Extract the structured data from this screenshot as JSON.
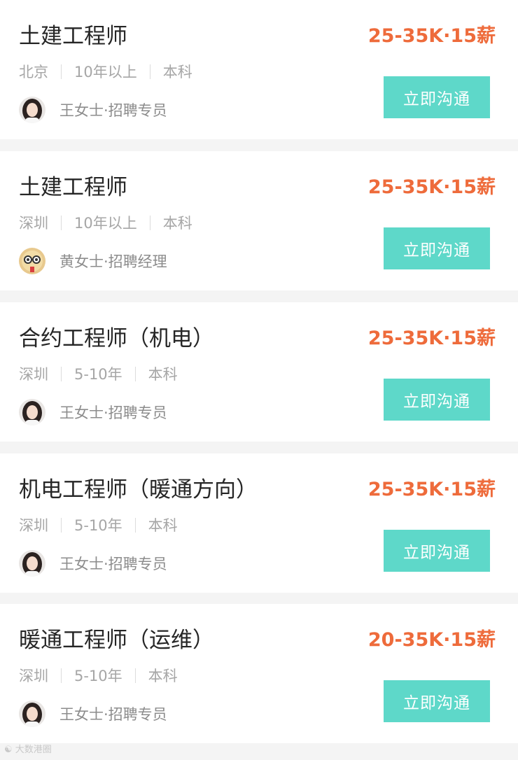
{
  "colors": {
    "salary": "#ee6b3b",
    "button": "#5ed8c9",
    "title": "#262626",
    "meta": "#a6a6a6",
    "divider": "#f4f4f4"
  },
  "jobs": [
    {
      "title": "土建工程师",
      "salary": "25-35K·15薪",
      "city": "北京",
      "experience": "10年以上",
      "education": "本科",
      "recruiter": "王女士·招聘专员",
      "avatar_icon": "avatar-woman-dark-hair-icon",
      "button_label": "立即沟通"
    },
    {
      "title": "土建工程师",
      "salary": "25-35K·15薪",
      "city": "深圳",
      "experience": "10年以上",
      "education": "本科",
      "recruiter": "黄女士·招聘经理",
      "avatar_icon": "avatar-cartoon-glasses-icon",
      "button_label": "立即沟通"
    },
    {
      "title": "合约工程师（机电）",
      "salary": "25-35K·15薪",
      "city": "深圳",
      "experience": "5-10年",
      "education": "本科",
      "recruiter": "王女士·招聘专员",
      "avatar_icon": "avatar-woman-dark-hair-icon",
      "button_label": "立即沟通"
    },
    {
      "title": "机电工程师（暖通方向）",
      "salary": "25-35K·15薪",
      "city": "深圳",
      "experience": "5-10年",
      "education": "本科",
      "recruiter": "王女士·招聘专员",
      "avatar_icon": "avatar-woman-dark-hair-icon",
      "button_label": "立即沟通"
    },
    {
      "title": "暖通工程师（运维）",
      "salary": "20-35K·15薪",
      "city": "深圳",
      "experience": "5-10年",
      "education": "本科",
      "recruiter": "王女士·招聘专员",
      "avatar_icon": "avatar-woman-dark-hair-icon",
      "button_label": "立即沟通"
    }
  ],
  "watermark": "大数港圈"
}
